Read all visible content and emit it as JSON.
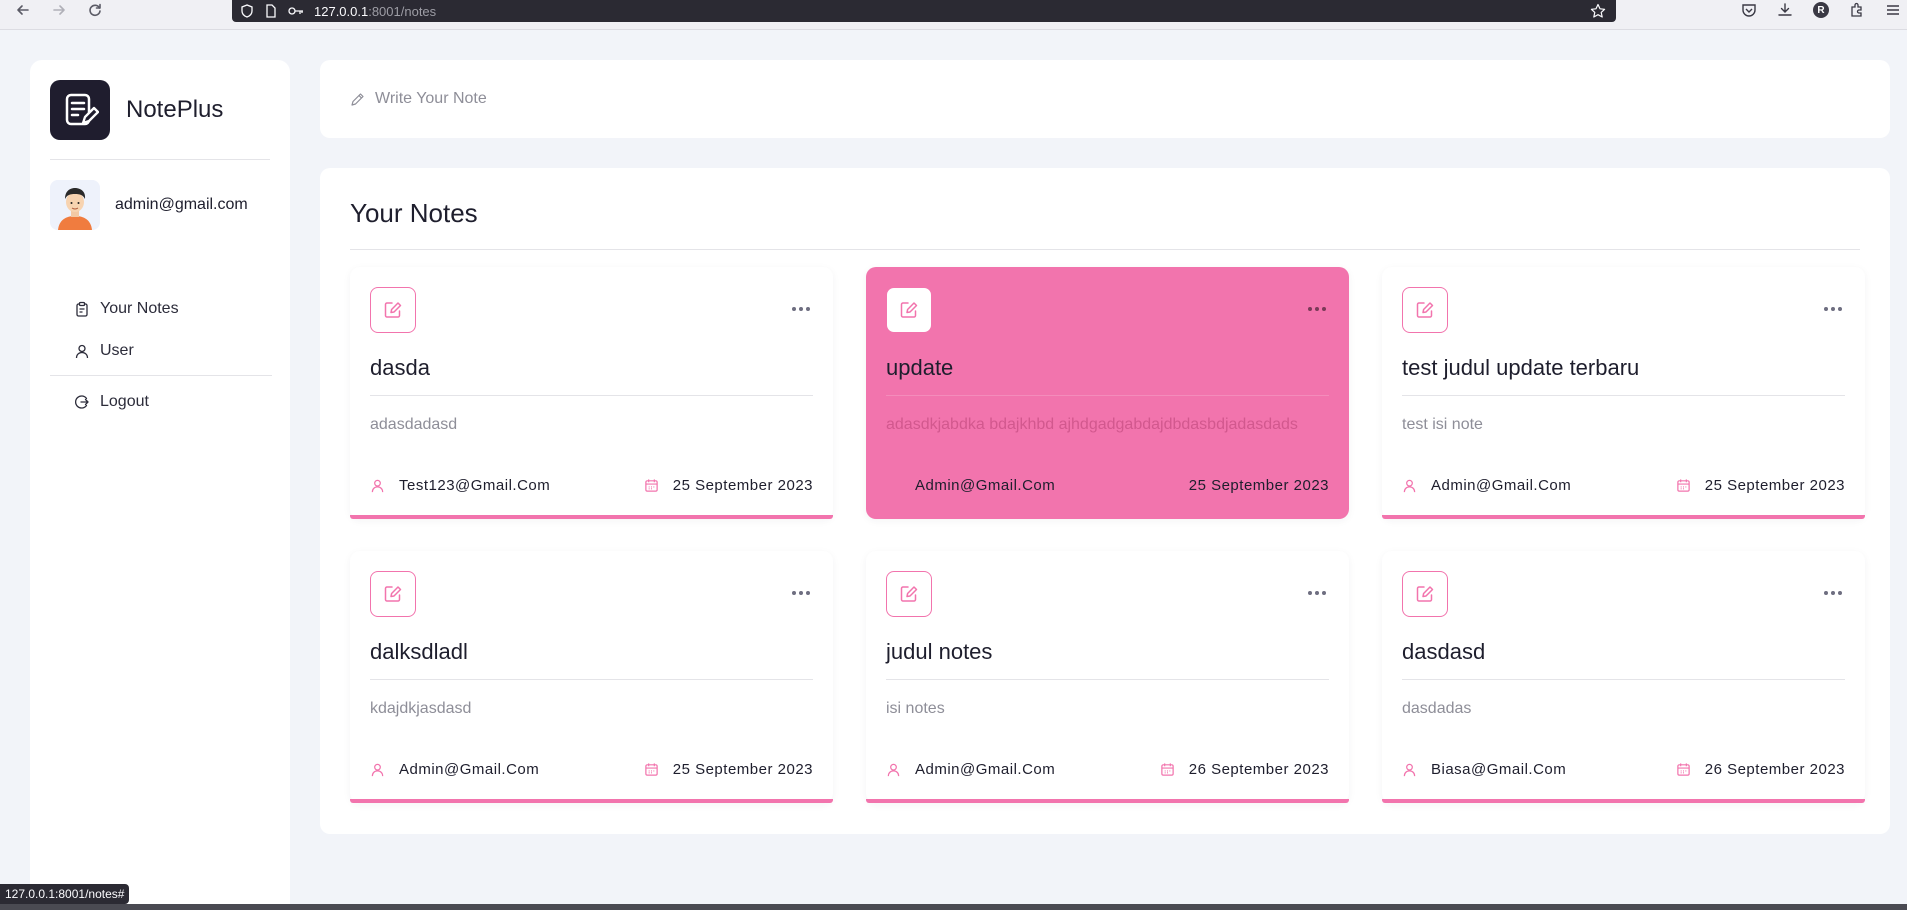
{
  "browser": {
    "url_host": "127.0.0.1",
    "url_rest": ":8001/notes",
    "profile_initial": "R",
    "status_url": "127.0.0.1:8001/notes#"
  },
  "sidebar": {
    "app_name": "NotePlus",
    "user_email": "admin@gmail.com",
    "menu": [
      {
        "label": "Your Notes",
        "icon": "clipboard-icon"
      },
      {
        "label": "User",
        "icon": "user-icon"
      }
    ],
    "logout_label": "Logout"
  },
  "compose": {
    "placeholder": "Write Your Note"
  },
  "notes_section": {
    "title": "Your Notes",
    "notes": [
      {
        "title": "dasda",
        "body": "adasdadasd",
        "author": "Test123@Gmail.Com",
        "date": "25 September 2023",
        "active": false
      },
      {
        "title": "update",
        "body": "adasdkjabdka bdajkhbd ajhdgadgabdajdbdasbdjadasdads",
        "author": "Admin@Gmail.Com",
        "date": "25 September 2023",
        "active": true
      },
      {
        "title": "test judul update terbaru",
        "body": "test isi note",
        "author": "Admin@Gmail.Com",
        "date": "25 September 2023",
        "active": false
      },
      {
        "title": "dalksdladl",
        "body": "kdajdkjasdasd",
        "author": "Admin@Gmail.Com",
        "date": "25 September 2023",
        "active": false
      },
      {
        "title": "judul notes",
        "body": "isi notes",
        "author": "Admin@Gmail.Com",
        "date": "26 September 2023",
        "active": false
      },
      {
        "title": "dasdasd",
        "body": "dasdadas",
        "author": "Biasa@Gmail.Com",
        "date": "26 September 2023",
        "active": false
      }
    ]
  },
  "colors": {
    "accent": "#f274ad",
    "dark": "#1f1d2e",
    "background": "#f2f4f9"
  }
}
